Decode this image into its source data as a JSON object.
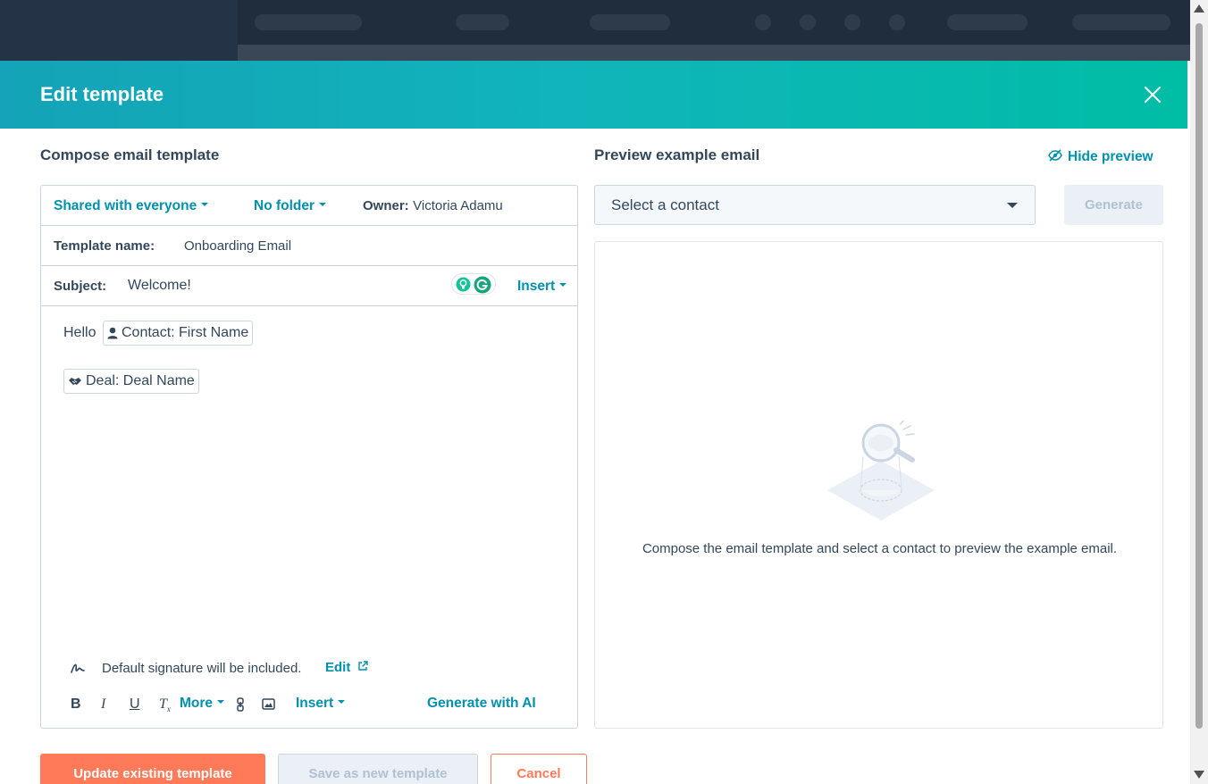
{
  "modal": {
    "title": "Edit template"
  },
  "compose": {
    "section_title": "Compose email template",
    "sharing_label": "Shared with everyone",
    "folder_label": "No folder",
    "owner_label": "Owner:",
    "owner_value": "Victoria Adamu",
    "template_name_label": "Template name:",
    "template_name_value": "Onboarding Email",
    "subject_label": "Subject:",
    "subject_value": "Welcome!",
    "insert_label": "Insert",
    "body_greeting": "Hello",
    "token_contact": "Contact: First Name",
    "token_deal": "Deal: Deal Name",
    "signature_text": "Default signature will be included.",
    "signature_edit": "Edit",
    "toolbar": {
      "more_label": "More",
      "insert_label": "Insert",
      "generate_ai_label": "Generate with AI"
    }
  },
  "preview": {
    "section_title": "Preview example email",
    "hide_preview_label": "Hide preview",
    "select_contact_value": "Select a contact",
    "generate_label": "Generate",
    "empty_message": "Compose the email template and select a contact to preview the example email."
  },
  "footer": {
    "update_label": "Update existing template",
    "save_new_label": "Save as new template",
    "cancel_label": "Cancel"
  },
  "colors": {
    "header_gradient_start": "#14a3b8",
    "header_gradient_end": "#00bda5",
    "link": "#0091ae",
    "primary_button": "#ff7a59",
    "text": "#33475b",
    "border": "#cbd6e2"
  }
}
